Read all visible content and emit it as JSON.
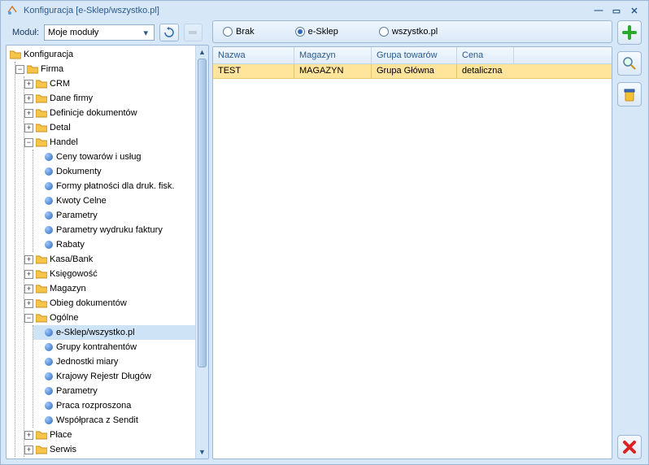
{
  "window_title": "Konfiguracja [e-Sklep/wszystko.pl]",
  "module_label": "Moduł:",
  "module_value": "Moje moduły",
  "radios": {
    "brak": "Brak",
    "esklep": "e-Sklep",
    "wszystko": "wszystko.pl"
  },
  "grid": {
    "headers": {
      "c1": "Nazwa",
      "c2": "Magazyn",
      "c3": "Grupa towarów",
      "c4": "Cena"
    },
    "row": {
      "c1": "TEST",
      "c2": "MAGAZYN",
      "c3": "Grupa Główna",
      "c4": "detaliczna"
    }
  },
  "tree": {
    "root": "Konfiguracja",
    "firma": "Firma",
    "crm": "CRM",
    "dane_firmy": "Dane firmy",
    "def_dok": "Definicje dokumentów",
    "detal": "Detal",
    "handel": "Handel",
    "ceny": "Ceny towarów i usług",
    "dokumenty": "Dokumenty",
    "formy": "Formy płatności dla druk. fisk.",
    "kwoty": "Kwoty Celne",
    "parametry": "Parametry",
    "param_wf": "Parametry wydruku faktury",
    "rabaty": "Rabaty",
    "kasa": "Kasa/Bank",
    "ksieg": "Księgowość",
    "magazyn": "Magazyn",
    "obieg": "Obieg dokumentów",
    "ogolne": "Ogólne",
    "esklep": "e-Sklep/wszystko.pl",
    "grupy": "Grupy kontrahentów",
    "jednostki": "Jednostki miary",
    "krd": "Krajowy Rejestr Długów",
    "parametry2": "Parametry",
    "praca": "Praca rozproszona",
    "sendit": "Współpraca z Sendit",
    "place": "Płace",
    "serwis": "Serwis"
  }
}
